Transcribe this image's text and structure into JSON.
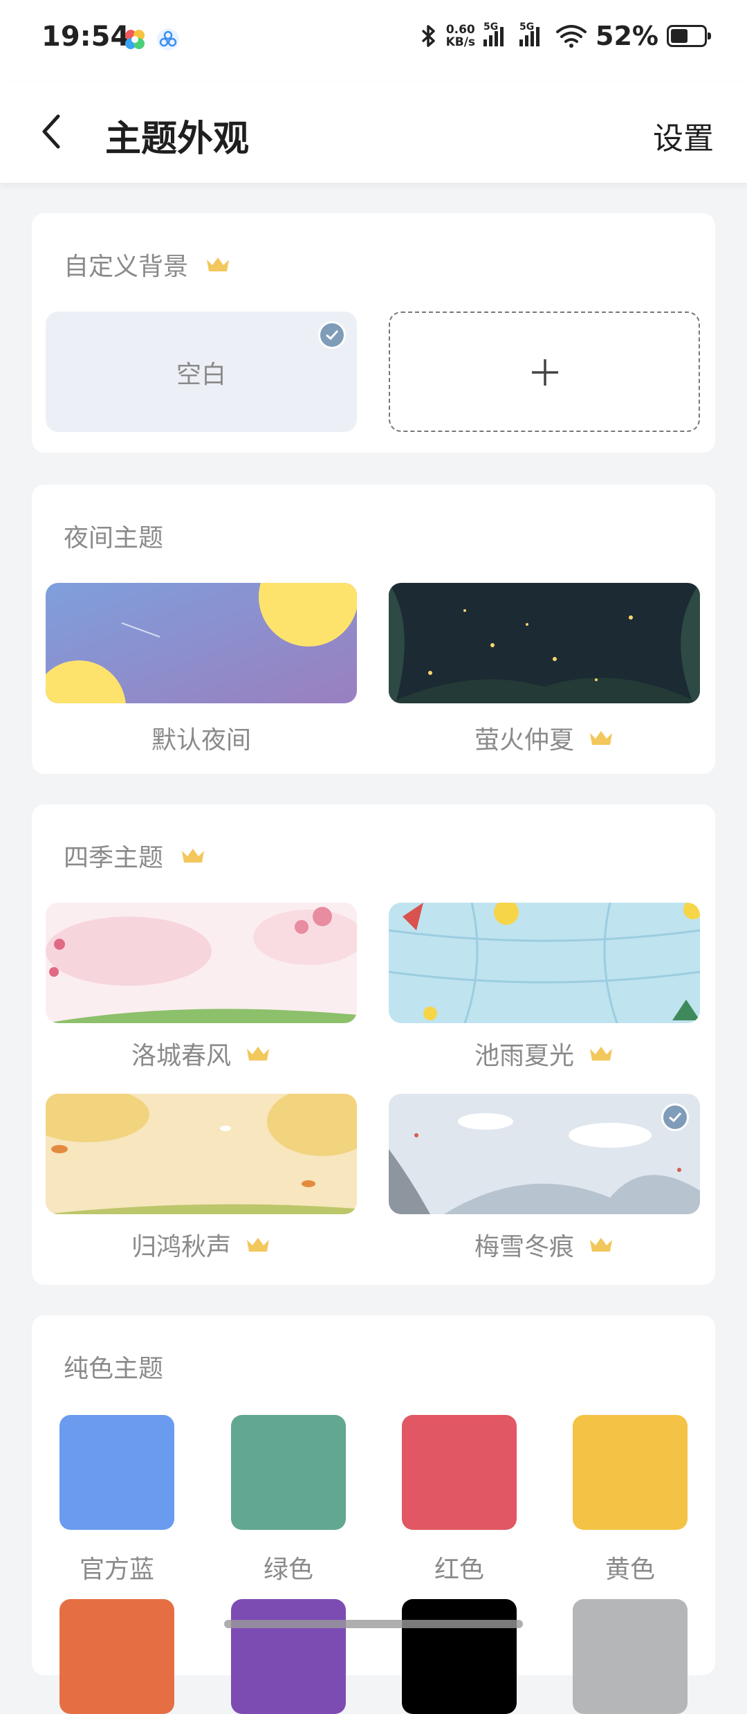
{
  "status_bar": {
    "time": "19:54",
    "net_speed_value": "0.60",
    "net_speed_unit": "KB/s",
    "signal1": "5G",
    "signal2": "5G",
    "battery_percent": "52%",
    "battery_level": 0.52
  },
  "header": {
    "title": "主题外观",
    "settings_label": "设置",
    "back_icon": "chevron-left-icon"
  },
  "custom_background": {
    "title": "自定义背景",
    "blank_label": "空白",
    "add_icon": "plus-icon"
  },
  "night_themes": {
    "title": "夜间主题",
    "items": [
      {
        "label": "默认夜间",
        "premium": false
      },
      {
        "label": "萤火仲夏",
        "premium": true
      }
    ]
  },
  "season_themes": {
    "title": "四季主题",
    "items": [
      {
        "label": "洛城春风",
        "premium": true
      },
      {
        "label": "池雨夏光",
        "premium": true
      },
      {
        "label": "归鸿秋声",
        "premium": true
      },
      {
        "label": "梅雪冬痕",
        "premium": true,
        "selected": true
      }
    ]
  },
  "solid_themes": {
    "title": "纯色主题",
    "items": [
      {
        "label": "官方蓝",
        "color": "#6a9bef"
      },
      {
        "label": "绿色",
        "color": "#62a791"
      },
      {
        "label": "红色",
        "color": "#e15763"
      },
      {
        "label": "黄色",
        "color": "#f4c244"
      },
      {
        "label": "",
        "color": "#e56f43"
      },
      {
        "label": "",
        "color": "#7d4cb3"
      },
      {
        "label": "",
        "color": "#000000"
      },
      {
        "label": "",
        "color": "#b5b6b8"
      }
    ]
  },
  "colors": {
    "background": "#f2f4f6",
    "card": "#ffffff",
    "crown": "#f2c75c",
    "check_badge": "#7f9cb8"
  }
}
